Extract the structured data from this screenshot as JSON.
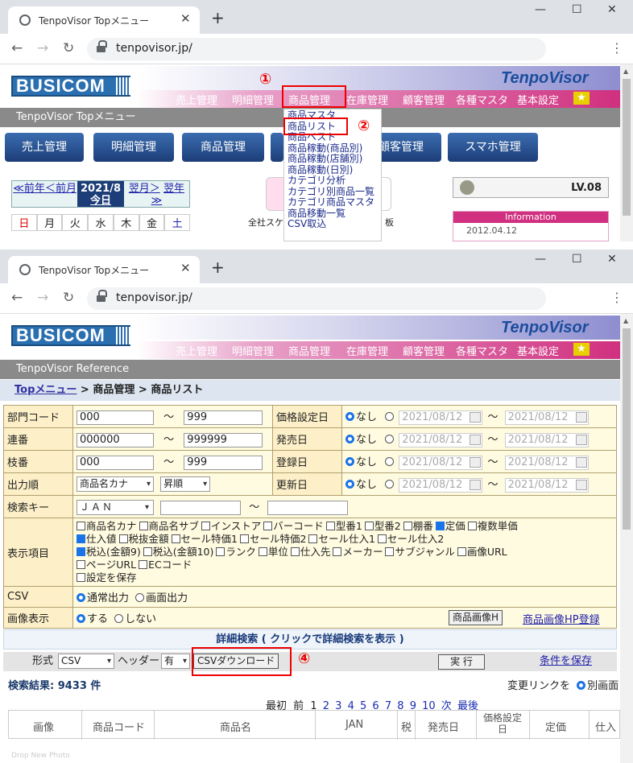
{
  "browser": {
    "tab_title": "TenpoVisor Topメニュー",
    "url": "tenpovisor.jp/"
  },
  "header": {
    "logo": "BUSICOM",
    "brand": "TenpoVisor",
    "menu": [
      "売上管理",
      "明細管理",
      "商品管理",
      "在庫管理",
      "顧客管理",
      "各種マスタ",
      "基本設定"
    ]
  },
  "shot1": {
    "page_title": "TenpoVisor Topメニュー",
    "big_buttons": [
      "売上管理",
      "明細管理",
      "商品管理",
      "顧客管理",
      "スマホ管理"
    ],
    "calendar": {
      "prev_year": "≪前年",
      "prev_month": "＜前月",
      "current": "2021/8",
      "today": "今日",
      "next_month": "翌月＞",
      "next_year": "翌年≫",
      "weekdays": [
        "日",
        "月",
        "火",
        "水",
        "木",
        "金",
        "土"
      ]
    },
    "dropdown_items": [
      "商品マスタ",
      "商品リスト",
      "商品ベスト",
      "商品稼動(商品別)",
      "商品稼動(店舗別)",
      "商品稼動(日別)",
      "カテゴリ分析",
      "カテゴリ別商品一覧",
      "カテゴリ商品マスタ",
      "商品移動一覧",
      "CSV取込"
    ],
    "icon_caption_left": "全社スケ",
    "icon_caption_right": "板",
    "level": "LV.08",
    "info_title": "Information",
    "info_date": "2012.04.12",
    "marker1": "①",
    "marker2": "②"
  },
  "shot2": {
    "page_title": "TenpoVisor Reference",
    "breadcrumb": {
      "top": "Topメニュー",
      "sep": ">",
      "mid": "商品管理",
      "current": "商品リスト"
    },
    "form": {
      "dept_label": "部門コード",
      "dept_from": "000",
      "dept_to": "999",
      "serial_label": "連番",
      "serial_from": "000000",
      "serial_to": "999999",
      "branch_label": "枝番",
      "branch_from": "000",
      "branch_to": "999",
      "order_label": "出力順",
      "order_value": "商品名カナ",
      "order_dir": "昇順",
      "key_label": "検索キー",
      "key_value": "ＪＡＮ",
      "tilde": "～",
      "price_date_label": "価格設定日",
      "release_label": "発売日",
      "reg_label": "登録日",
      "upd_label": "更新日",
      "none_label": "なし",
      "date_from": "2021/08/12",
      "date_to": "2021/08/12",
      "display_label": "表示項目",
      "display_items": [
        {
          "label": "商品名カナ",
          "checked": false
        },
        {
          "label": "商品名サブ",
          "checked": false
        },
        {
          "label": "インストア",
          "checked": false
        },
        {
          "label": "バーコード",
          "checked": false
        },
        {
          "label": "型番1",
          "checked": false
        },
        {
          "label": "型番2",
          "checked": false
        },
        {
          "label": "棚番",
          "checked": false
        },
        {
          "label": "定価",
          "checked": true
        },
        {
          "label": "複数単価",
          "checked": false
        },
        {
          "label": "仕入値",
          "checked": true
        },
        {
          "label": "税抜金額",
          "checked": false
        },
        {
          "label": "セール特価1",
          "checked": false
        },
        {
          "label": "セール特価2",
          "checked": false
        },
        {
          "label": "セール仕入1",
          "checked": false
        },
        {
          "label": "セール仕入2",
          "checked": false
        },
        {
          "label": "税込(金額9)",
          "checked": true
        },
        {
          "label": "税込(金額10)",
          "checked": false
        },
        {
          "label": "ランク",
          "checked": false
        },
        {
          "label": "単位",
          "checked": false
        },
        {
          "label": "仕入先",
          "checked": false
        },
        {
          "label": "メーカー",
          "checked": false
        },
        {
          "label": "サブジャンル",
          "checked": false
        },
        {
          "label": "画像URL",
          "checked": false
        },
        {
          "label": "ページURL",
          "checked": false
        },
        {
          "label": "ECコード",
          "checked": false
        },
        {
          "label": "設定を保存",
          "checked": false
        }
      ],
      "csv_label": "CSV",
      "csv_normal": "通常出力",
      "csv_screen": "画面出力",
      "image_label": "画像表示",
      "image_yes": "する",
      "image_no": "しない",
      "image_button": "商品画像H",
      "image_link": "商品画像HP登録"
    },
    "detail_search": "詳細検索 ( クリックで詳細検索を表示 )",
    "toolbar": {
      "format_label": "形式",
      "format_value": "CSV",
      "header_label": "ヘッダー",
      "header_value": "有",
      "download_button": "CSVダウンロード",
      "run_button": "実 行",
      "save_link": "条件を保存"
    },
    "marker4": "④",
    "result": "検索結果: 9433 件",
    "change_link_label": "変更リンクを",
    "change_link_option": "別画面",
    "pager": {
      "first": "最初",
      "prev": "前",
      "current": "1",
      "pages": [
        "2",
        "3",
        "4",
        "5",
        "6",
        "7",
        "8",
        "9",
        "10"
      ],
      "next": "次",
      "last": "最後"
    },
    "columns": [
      "画像",
      "商品コード",
      "商品名",
      "JAN",
      "税",
      "発売日",
      "価格設定日",
      "定価",
      "仕入"
    ],
    "row_hint": "Drop New Photo"
  }
}
